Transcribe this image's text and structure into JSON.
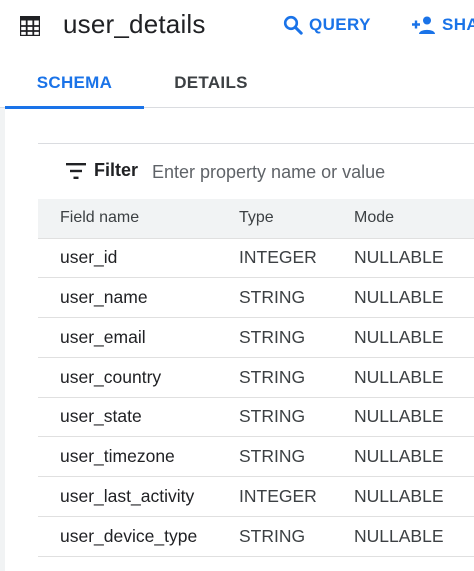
{
  "header": {
    "title": "user_details",
    "actions": {
      "query": "QUERY",
      "share": "SHA"
    }
  },
  "tabs": [
    {
      "label": "SCHEMA",
      "active": true
    },
    {
      "label": "DETAILS",
      "active": false
    }
  ],
  "filter": {
    "label": "Filter",
    "placeholder": "Enter property name or value",
    "value": ""
  },
  "schema": {
    "columns": [
      "Field name",
      "Type",
      "Mode"
    ],
    "rows": [
      {
        "name": "user_id",
        "type": "INTEGER",
        "mode": "NULLABLE"
      },
      {
        "name": "user_name",
        "type": "STRING",
        "mode": "NULLABLE"
      },
      {
        "name": "user_email",
        "type": "STRING",
        "mode": "NULLABLE"
      },
      {
        "name": "user_country",
        "type": "STRING",
        "mode": "NULLABLE"
      },
      {
        "name": "user_state",
        "type": "STRING",
        "mode": "NULLABLE"
      },
      {
        "name": "user_timezone",
        "type": "STRING",
        "mode": "NULLABLE"
      },
      {
        "name": "user_last_activity",
        "type": "INTEGER",
        "mode": "NULLABLE"
      },
      {
        "name": "user_device_type",
        "type": "STRING",
        "mode": "NULLABLE"
      }
    ]
  },
  "colors": {
    "accent": "#1a73e8",
    "text": "#202124",
    "muted": "#5f6368",
    "header_bg": "#f1f3f4",
    "divider": "#dadce0"
  },
  "icons": {
    "table": "table-icon",
    "query": "search-icon",
    "share": "person-add-icon",
    "filter": "filter-icon"
  }
}
